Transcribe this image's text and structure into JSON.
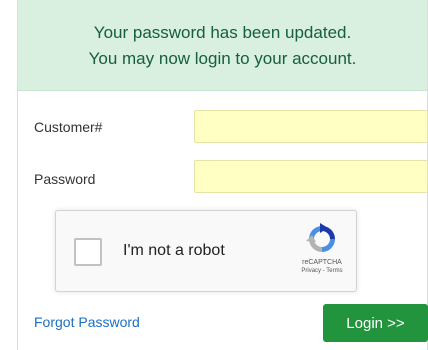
{
  "alert": {
    "line1": "Your password has been updated.",
    "line2": "You may now login to your account."
  },
  "form": {
    "customer_label": "Customer#",
    "customer_value": "",
    "password_label": "Password",
    "password_value": ""
  },
  "recaptcha": {
    "label": "I'm not a robot",
    "brand": "reCAPTCHA",
    "privacy": "Privacy",
    "terms": "Terms",
    "separator": " - "
  },
  "actions": {
    "forgot_label": "Forgot Password",
    "login_label": "Login >>"
  },
  "colors": {
    "alert_bg": "#d9efe0",
    "alert_text": "#155f3a",
    "input_bg": "#ffffc4",
    "link": "#1a6fc4",
    "login_button": "#22943e"
  }
}
